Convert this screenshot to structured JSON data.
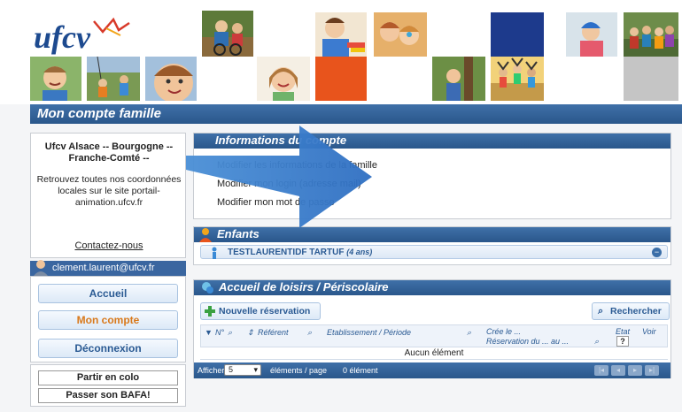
{
  "header": {
    "logo_text": "ufcv"
  },
  "banner": {
    "title": "Mon compte famille"
  },
  "sidebar": {
    "org_name": "Ufcv Alsace -- Bourgogne -- Franche-Comté --",
    "description": "Retrouvez toutes nos coordonnées locales sur le site portail-animation.ufcv.fr",
    "contact_link": "Contactez-nous",
    "user_email": "clement.laurent@ufcv.fr",
    "menu": {
      "home": "Accueil",
      "account": "Mon compte",
      "logout": "Déconnexion"
    },
    "promo": {
      "colo": "Partir en colo",
      "bafa": "Passer son BAFA!"
    }
  },
  "account_info": {
    "title": "Informations du compte",
    "links": {
      "family": "Modifier les informations de la famille",
      "login": "Modifier mon login (adresse mail)",
      "password": "Modifier mon mot de passe"
    }
  },
  "children": {
    "title": "Enfants",
    "child_name": "TESTLAURENTIDF TARTUF",
    "child_age": "(4 ans)"
  },
  "leisure": {
    "title": "Accueil de loisirs / Périscolaire",
    "new_button": "Nouvelle réservation",
    "search_button": "Rechercher",
    "columns": {
      "num": "N°",
      "referent": "Référent",
      "establishment": "Etablissement / Période",
      "created": "Crée le ...",
      "reservation": "Réservation du ... au ...",
      "state": "Etat",
      "state_value": "?",
      "view": "Voir"
    },
    "empty_text": "Aucun élément",
    "pager": {
      "show": "Afficher",
      "page_size": "5",
      "per_page": "éléments / page",
      "count": "0 élément"
    }
  },
  "colors": {
    "primary_blue": "#2a578b",
    "accent_orange": "#d9791b",
    "logo_blue": "#1d4a8f",
    "logo_red": "#d83a2a"
  }
}
